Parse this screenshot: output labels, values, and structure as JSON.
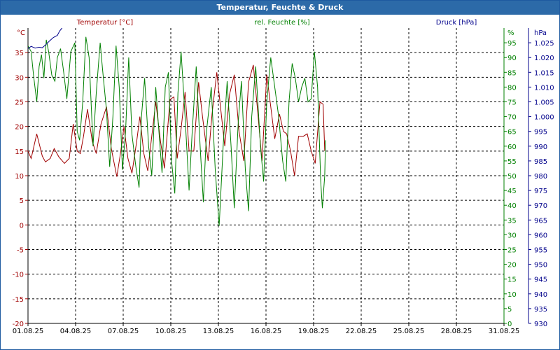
{
  "header": {
    "title": "Temperatur, Feuchte & Druck"
  },
  "chart_data": {
    "type": "line",
    "x_ticks": [
      "01.08.25",
      "04.08.25",
      "07.08.25",
      "10.08.25",
      "13.08.25",
      "16.08.25",
      "19.08.25",
      "22.08.25",
      "25.08.25",
      "28.08.25",
      "31.08.25"
    ],
    "xlim": [
      "2025-08-01",
      "2025-08-31"
    ],
    "grid": true,
    "axes": {
      "temperature": {
        "unit": "°C",
        "ylim": [
          -20,
          40
        ],
        "ticks": [
          -20,
          -15,
          -10,
          -5,
          0,
          5,
          10,
          15,
          20,
          25,
          30,
          35
        ],
        "color": "#a00000"
      },
      "humidity": {
        "unit": "%",
        "ylim": [
          0,
          100
        ],
        "ticks": [
          0,
          5,
          10,
          15,
          20,
          25,
          30,
          35,
          40,
          45,
          50,
          55,
          60,
          65,
          70,
          75,
          80,
          85,
          90,
          95
        ],
        "color": "#008000"
      },
      "pressure": {
        "unit": "hPa",
        "ylim": [
          930,
          1030
        ],
        "ticks": [
          930,
          935,
          940,
          945,
          950,
          955,
          960,
          965,
          970,
          975,
          980,
          985,
          990,
          995,
          1000,
          1005,
          1010,
          1015,
          1020,
          1025
        ],
        "color": "#00008b"
      }
    },
    "series": [
      {
        "name": "Temperatur [°C]",
        "axis": "temperature",
        "color": "#a00000",
        "points": [
          [
            0.0,
            15.0
          ],
          [
            0.2,
            13.5
          ],
          [
            0.55,
            18.5
          ],
          [
            0.9,
            14.0
          ],
          [
            1.1,
            12.8
          ],
          [
            1.4,
            13.5
          ],
          [
            1.65,
            15.5
          ],
          [
            1.95,
            13.8
          ],
          [
            2.3,
            12.5
          ],
          [
            2.6,
            13.5
          ],
          [
            2.85,
            20.5
          ],
          [
            3.1,
            15.0
          ],
          [
            3.3,
            14.5
          ],
          [
            3.5,
            18.0
          ],
          [
            3.75,
            23.5
          ],
          [
            4.05,
            17.0
          ],
          [
            4.3,
            14.5
          ],
          [
            4.6,
            20.5
          ],
          [
            4.95,
            24.0
          ],
          [
            5.25,
            15.5
          ],
          [
            5.6,
            9.8
          ],
          [
            5.85,
            15.0
          ],
          [
            6.05,
            20.0
          ],
          [
            6.3,
            13.5
          ],
          [
            6.55,
            10.5
          ],
          [
            6.85,
            17.0
          ],
          [
            7.05,
            22.0
          ],
          [
            7.3,
            14.5
          ],
          [
            7.55,
            11.0
          ],
          [
            7.8,
            18.0
          ],
          [
            8.05,
            25.0
          ],
          [
            8.35,
            17.0
          ],
          [
            8.6,
            11.5
          ],
          [
            8.95,
            25.5
          ],
          [
            9.2,
            26.0
          ],
          [
            9.4,
            13.5
          ],
          [
            9.65,
            19.5
          ],
          [
            9.9,
            27.0
          ],
          [
            10.15,
            15.0
          ],
          [
            10.45,
            15.0
          ],
          [
            10.75,
            29.0
          ],
          [
            11.0,
            22.0
          ],
          [
            11.35,
            13.0
          ],
          [
            11.6,
            22.5
          ],
          [
            11.9,
            31.0
          ],
          [
            12.2,
            22.0
          ],
          [
            12.4,
            16.0
          ],
          [
            12.7,
            26.5
          ],
          [
            13.0,
            30.5
          ],
          [
            13.3,
            19.0
          ],
          [
            13.6,
            13.0
          ],
          [
            13.9,
            29.0
          ],
          [
            14.2,
            32.5
          ],
          [
            14.45,
            24.0
          ],
          [
            14.75,
            13.0
          ],
          [
            15.05,
            30.5
          ],
          [
            15.3,
            24.0
          ],
          [
            15.55,
            17.5
          ],
          [
            15.85,
            22.5
          ],
          [
            16.1,
            19.0
          ],
          [
            16.3,
            18.5
          ],
          [
            16.55,
            15.0
          ],
          [
            16.8,
            10.0
          ],
          [
            17.05,
            18.0
          ],
          [
            17.35,
            18.0
          ],
          [
            17.6,
            18.5
          ],
          [
            17.85,
            15.0
          ],
          [
            18.1,
            12.5
          ],
          [
            18.4,
            25.0
          ],
          [
            18.6,
            24.5
          ],
          [
            18.7,
            15.0
          ]
        ]
      },
      {
        "name": "rel. Feuchte [%]",
        "axis": "humidity",
        "color": "#008000",
        "points": [
          [
            0.0,
            94.0
          ],
          [
            0.2,
            92.0
          ],
          [
            0.35,
            84.0
          ],
          [
            0.55,
            75.0
          ],
          [
            0.7,
            87.0
          ],
          [
            0.85,
            91.0
          ],
          [
            1.0,
            83.0
          ],
          [
            1.15,
            96.0
          ],
          [
            1.3,
            92.0
          ],
          [
            1.5,
            84.0
          ],
          [
            1.7,
            82.0
          ],
          [
            1.85,
            90.0
          ],
          [
            2.05,
            93.0
          ],
          [
            2.25,
            85.0
          ],
          [
            2.45,
            76.0
          ],
          [
            2.7,
            92.0
          ],
          [
            2.95,
            95.0
          ],
          [
            3.1,
            65.0
          ],
          [
            3.25,
            62.0
          ],
          [
            3.45,
            75.0
          ],
          [
            3.65,
            97.0
          ],
          [
            3.85,
            90.0
          ],
          [
            4.1,
            60.0
          ],
          [
            4.3,
            78.0
          ],
          [
            4.55,
            95.0
          ],
          [
            4.7,
            86.0
          ],
          [
            4.95,
            72.0
          ],
          [
            5.15,
            53.0
          ],
          [
            5.35,
            70.0
          ],
          [
            5.55,
            94.0
          ],
          [
            5.75,
            80.0
          ],
          [
            5.95,
            52.0
          ],
          [
            6.15,
            65.0
          ],
          [
            6.35,
            90.0
          ],
          [
            6.55,
            64.0
          ],
          [
            6.8,
            53.0
          ],
          [
            7.0,
            46.0
          ],
          [
            7.15,
            70.0
          ],
          [
            7.35,
            83.0
          ],
          [
            7.6,
            60.0
          ],
          [
            7.8,
            50.0
          ],
          [
            8.05,
            80.0
          ],
          [
            8.25,
            65.0
          ],
          [
            8.45,
            51.0
          ],
          [
            8.65,
            80.0
          ],
          [
            8.85,
            85.0
          ],
          [
            9.05,
            55.0
          ],
          [
            9.25,
            44.0
          ],
          [
            9.45,
            78.0
          ],
          [
            9.65,
            92.0
          ],
          [
            9.9,
            70.0
          ],
          [
            10.15,
            45.0
          ],
          [
            10.35,
            65.0
          ],
          [
            10.6,
            87.0
          ],
          [
            10.85,
            60.0
          ],
          [
            11.05,
            41.0
          ],
          [
            11.25,
            65.0
          ],
          [
            11.55,
            80.0
          ],
          [
            11.8,
            52.0
          ],
          [
            12.05,
            33.0
          ],
          [
            12.3,
            60.0
          ],
          [
            12.55,
            82.0
          ],
          [
            12.8,
            60.0
          ],
          [
            13.0,
            39.0
          ],
          [
            13.25,
            68.0
          ],
          [
            13.45,
            82.0
          ],
          [
            13.7,
            52.0
          ],
          [
            13.9,
            38.0
          ],
          [
            14.1,
            70.0
          ],
          [
            14.35,
            87.0
          ],
          [
            14.65,
            60.0
          ],
          [
            14.85,
            48.0
          ],
          [
            15.05,
            75.0
          ],
          [
            15.3,
            90.0
          ],
          [
            15.55,
            80.0
          ],
          [
            15.8,
            70.0
          ],
          [
            16.05,
            55.0
          ],
          [
            16.25,
            48.0
          ],
          [
            16.45,
            75.0
          ],
          [
            16.65,
            88.0
          ],
          [
            16.85,
            83.0
          ],
          [
            17.05,
            75.0
          ],
          [
            17.25,
            80.0
          ],
          [
            17.45,
            83.0
          ],
          [
            17.65,
            75.0
          ],
          [
            17.85,
            76.0
          ],
          [
            18.05,
            92.0
          ],
          [
            18.25,
            80.0
          ],
          [
            18.45,
            48.0
          ],
          [
            18.55,
            39.0
          ],
          [
            18.7,
            50.0
          ],
          [
            18.75,
            62.0
          ]
        ]
      },
      {
        "name": "Druck [hPa]",
        "axis": "pressure",
        "color": "#00008b",
        "points": [
          [
            0.0,
            1023.0
          ],
          [
            0.2,
            1023.8
          ],
          [
            0.45,
            1023.2
          ],
          [
            0.7,
            1023.5
          ],
          [
            0.9,
            1023.3
          ],
          [
            1.15,
            1024.5
          ],
          [
            1.35,
            1025.6
          ],
          [
            1.6,
            1026.8
          ],
          [
            1.85,
            1027.5
          ],
          [
            2.0,
            1029.0
          ],
          [
            2.15,
            1030.0
          ]
        ]
      }
    ]
  }
}
